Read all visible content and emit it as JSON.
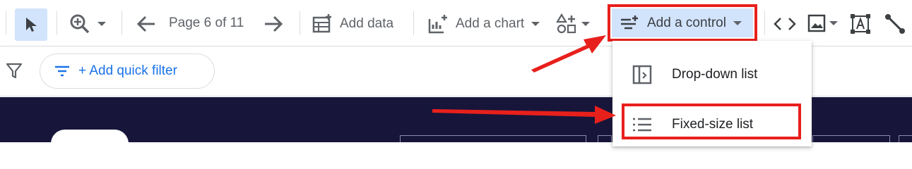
{
  "toolbar": {
    "page_label": "Page 6 of 11",
    "add_data_label": "Add data",
    "add_chart_label": "Add a chart",
    "add_control_label": "Add a control"
  },
  "filter_bar": {
    "quick_filter_label": "+ Add quick filter"
  },
  "control_menu": {
    "items": [
      {
        "label": "Drop-down list",
        "icon": "dropdown-list-icon"
      },
      {
        "label": "Fixed-size list",
        "icon": "list-icon"
      }
    ]
  },
  "colors": {
    "selected_bg": "#d2e3fc",
    "accent_blue": "#1a73e8",
    "highlight_red": "#e8201c",
    "canvas_bg": "#17153a"
  }
}
